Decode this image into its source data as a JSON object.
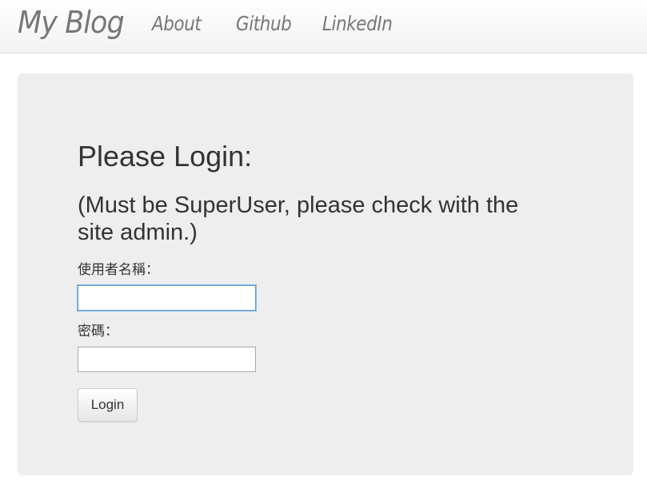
{
  "navbar": {
    "brand": "My Blog",
    "links": [
      {
        "label": "About"
      },
      {
        "label": "Github"
      },
      {
        "label": "LinkedIn"
      }
    ]
  },
  "login": {
    "title": "Please Login:",
    "subtitle": "(Must be SuperUser, please check with the site admin.)",
    "username_label": "使用者名稱：",
    "username_value": "",
    "password_label": "密碼：",
    "password_value": "",
    "submit_label": "Login"
  },
  "colors": {
    "navbar_text": "#777777",
    "panel_background": "#eeeeee",
    "focus_border": "#5b9dd9"
  }
}
